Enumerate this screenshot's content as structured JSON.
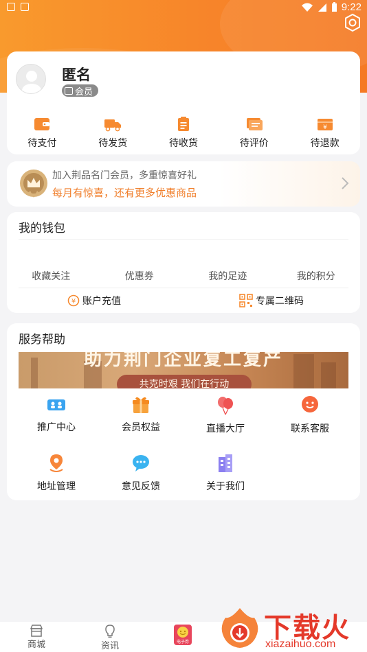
{
  "status_bar": {
    "time": "9:22"
  },
  "profile": {
    "username": "匿名",
    "badge": "会员"
  },
  "orders": [
    {
      "label": "待支付",
      "icon": "wallet-icon"
    },
    {
      "label": "待发货",
      "icon": "truck-icon"
    },
    {
      "label": "待收货",
      "icon": "clipboard-icon"
    },
    {
      "label": "待评价",
      "icon": "comment-icon"
    },
    {
      "label": "待退款",
      "icon": "refund-icon"
    }
  ],
  "vip_banner": {
    "line1": "加入荆品名门会员，多重惊喜好礼",
    "line2": "每月有惊喜，还有更多优惠商品"
  },
  "wallet": {
    "title": "我的钱包",
    "tabs": [
      "收藏关注",
      "优惠券",
      "我的足迹",
      "我的积分"
    ],
    "recharge": "账户充值",
    "qrcode": "专属二维码"
  },
  "service": {
    "title": "服务帮助",
    "banner_title": "助力荆门企业复工复产",
    "banner_sub": "共克时艰 我们在行动",
    "items": [
      {
        "label": "推广中心",
        "icon": "promotion-icon"
      },
      {
        "label": "会员权益",
        "icon": "gift-icon"
      },
      {
        "label": "直播大厅",
        "icon": "balloon-icon"
      },
      {
        "label": "联系客服",
        "icon": "customer-service-icon"
      },
      {
        "label": "地址管理",
        "icon": "location-icon"
      },
      {
        "label": "意见反馈",
        "icon": "feedback-icon"
      },
      {
        "label": "关于我们",
        "icon": "building-icon"
      }
    ]
  },
  "tabbar": {
    "shop": "商城",
    "news": "资讯",
    "ticket_text": "电子券"
  },
  "watermark": {
    "brand": "下载火",
    "url": "xiazaihuo.com"
  },
  "colors": {
    "accent": "#f7852a",
    "vip_text": "#f07e2a",
    "watermark": "#e4392a"
  }
}
